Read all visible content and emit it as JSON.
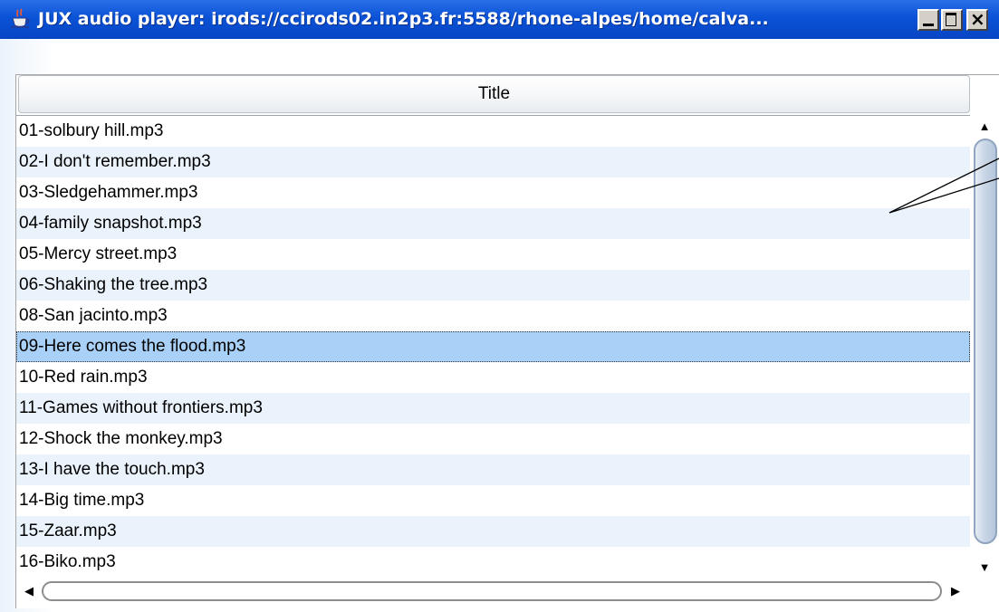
{
  "window": {
    "title": "JUX audio player: irods://ccirods02.in2p3.fr:5588/rhone-alpes/home/calva..."
  },
  "table": {
    "column_header": "Title",
    "rows": [
      "01-solbury hill.mp3",
      "02-I don't remember.mp3",
      "03-Sledgehammer.mp3",
      "04-family snapshot.mp3",
      "05-Mercy street.mp3",
      "06-Shaking the tree.mp3",
      "08-San jacinto.mp3",
      "09-Here comes the flood.mp3",
      "10-Red rain.mp3",
      "11-Games without frontiers.mp3",
      "12-Shock the monkey.mp3",
      "13-I have the touch.mp3",
      "14-Big time.mp3",
      "15-Zaar.mp3",
      "16-Biko.mp3"
    ],
    "selected_index": 7
  },
  "scrollbars": {
    "vertical": {
      "up_icon": "arrow-up-icon",
      "down_icon": "arrow-down-icon"
    },
    "horizontal": {
      "left_icon": "arrow-left-icon",
      "right_icon": "arrow-right-icon"
    }
  },
  "colors": {
    "titlebar": "#0a52d6",
    "row_alt": "#eaf3fc",
    "row_selected": "#a9d0f7"
  }
}
